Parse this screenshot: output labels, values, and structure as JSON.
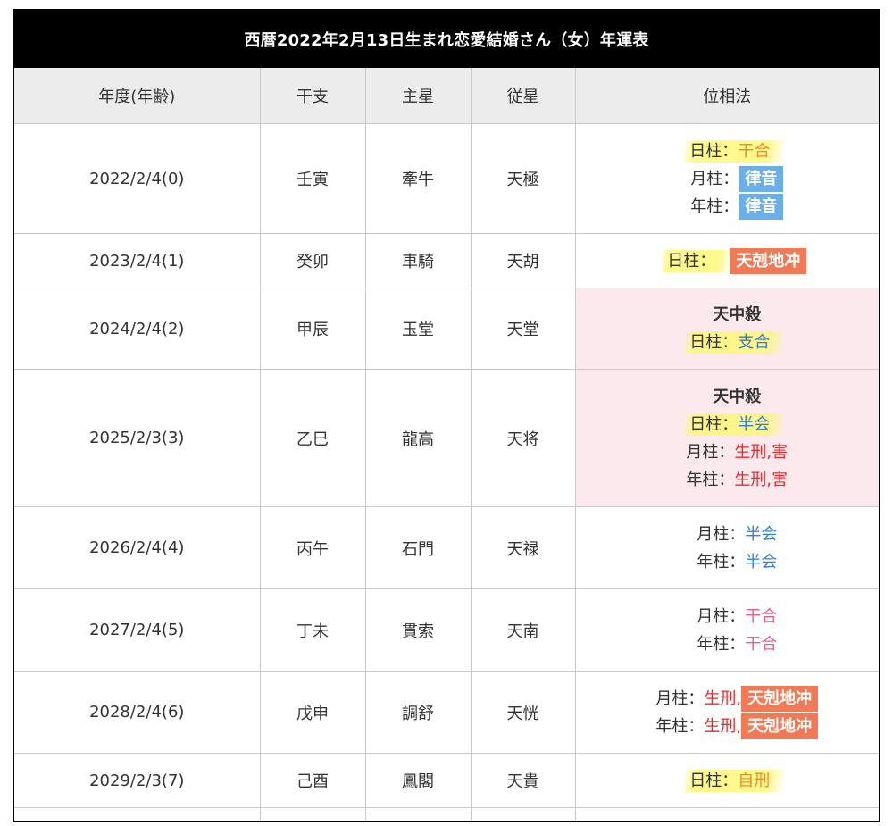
{
  "title": "西暦2022年2月13日生まれ恋愛結婚さん（女）年運表",
  "headers": [
    "年度(年齢)",
    "干支",
    "主星",
    "従星",
    "位相法"
  ],
  "label_sep": "：",
  "comma": ",",
  "tenchu_label": "天中殺",
  "rows": [
    {
      "year": "2022/2/4(0)",
      "kanshi": "壬寅",
      "main_star": "牽牛",
      "sub_star": "天極",
      "lines": [
        {
          "label": "日柱",
          "value": "干合"
        },
        {
          "label": "月柱",
          "value": "律音"
        },
        {
          "label": "年柱",
          "value": "律音"
        }
      ]
    },
    {
      "year": "2023/2/4(1)",
      "kanshi": "癸卯",
      "main_star": "車騎",
      "sub_star": "天胡",
      "lines": [
        {
          "label": "日柱",
          "value": "天剋地冲"
        }
      ]
    },
    {
      "year": "2024/2/4(2)",
      "kanshi": "甲辰",
      "main_star": "玉堂",
      "sub_star": "天堂",
      "lines": [
        {
          "label": "日柱",
          "value": "支合"
        }
      ]
    },
    {
      "year": "2025/2/3(3)",
      "kanshi": "乙巳",
      "main_star": "龍高",
      "sub_star": "天将",
      "lines": [
        {
          "label": "日柱",
          "value": "半会"
        },
        {
          "label": "月柱",
          "value": "生刑",
          "value2": "害"
        },
        {
          "label": "年柱",
          "value": "生刑",
          "value2": "害"
        }
      ]
    },
    {
      "year": "2026/2/4(4)",
      "kanshi": "丙午",
      "main_star": "石門",
      "sub_star": "天禄",
      "lines": [
        {
          "label": "月柱",
          "value": "半会"
        },
        {
          "label": "年柱",
          "value": "半会"
        }
      ]
    },
    {
      "year": "2027/2/4(5)",
      "kanshi": "丁未",
      "main_star": "貫索",
      "sub_star": "天南",
      "lines": [
        {
          "label": "月柱",
          "value": "干合"
        },
        {
          "label": "年柱",
          "value": "干合"
        }
      ]
    },
    {
      "year": "2028/2/4(6)",
      "kanshi": "戊申",
      "main_star": "調舒",
      "sub_star": "天恍",
      "lines": [
        {
          "label": "月柱",
          "value": "生刑",
          "value2": "天剋地冲"
        },
        {
          "label": "年柱",
          "value": "生刑",
          "value2": "天剋地冲"
        }
      ]
    },
    {
      "year": "2029/2/3(7)",
      "kanshi": "己酉",
      "main_star": "鳳閣",
      "sub_star": "天貴",
      "lines": [
        {
          "label": "日柱",
          "value": "自刑"
        }
      ]
    }
  ],
  "colors": {
    "orange_text": "#f08a2c",
    "pink_text": "#ec5f86",
    "red_text": "#e8292c",
    "blue_text": "#2f7fe0",
    "blue_badge": "#6aaeea",
    "salmon_badge": "#ef7a55",
    "highlight": "#fff778",
    "tenchu_bg": "#fbe9ee"
  }
}
